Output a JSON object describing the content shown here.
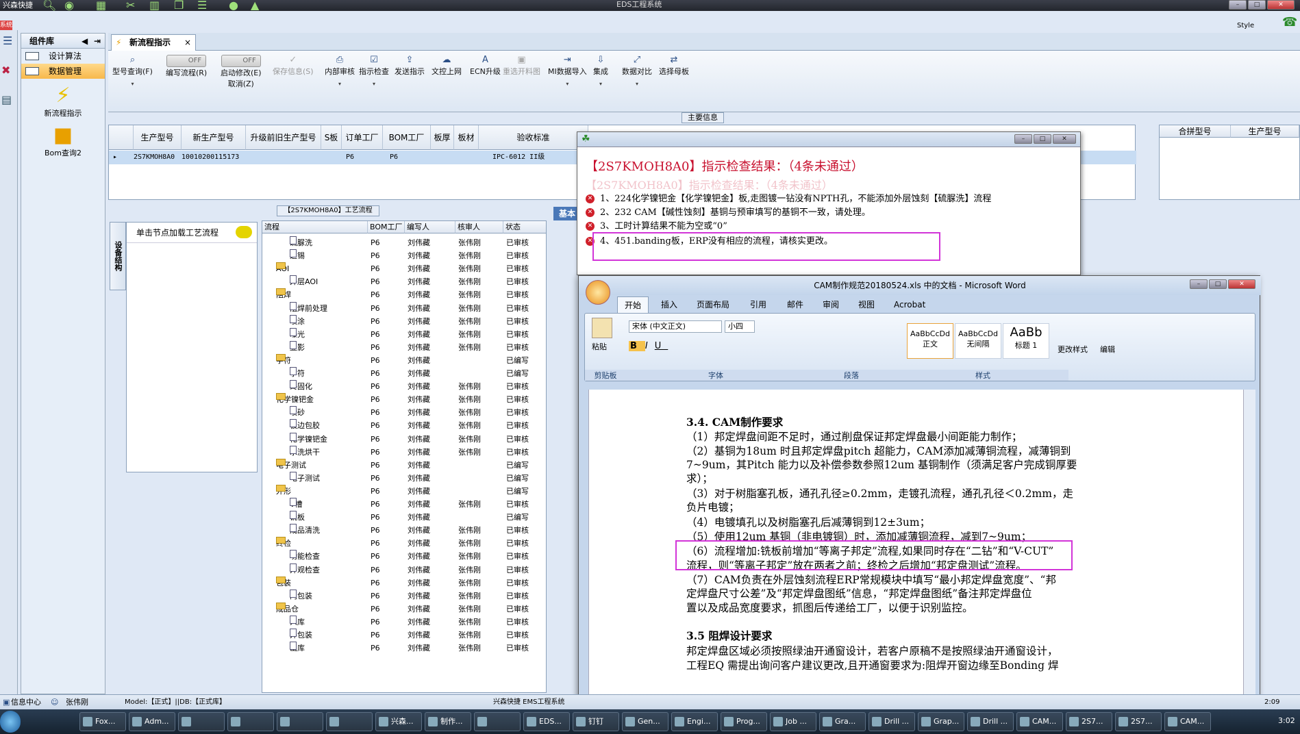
{
  "app": {
    "title": "EDS工程系统",
    "sys_name": "兴森快捷",
    "style_label": "Style",
    "red_tag": "系统"
  },
  "complib": {
    "header": "组件库",
    "items": [
      {
        "label": "设计算法"
      },
      {
        "label": "数据管理"
      }
    ],
    "tiles": [
      {
        "label": "新流程指示"
      },
      {
        "label": "Bom查询2"
      }
    ]
  },
  "tab": {
    "label": "新流程指示",
    "close": "×"
  },
  "ribbon": {
    "model_query": "型号查询(F)",
    "edit_flow": "编写流程(R)",
    "start_modify": "启动修改(E)",
    "cancel": "取消(Z)",
    "off_label": "OFF",
    "save_info": "保存信息(S)",
    "internal_review": "内部审核",
    "instruction_check": "指示检查",
    "send_instruction": "发送指示",
    "upload": "文控上网",
    "ecn_upgrade": "ECN升级",
    "reselect_image": "重选开料图",
    "mi_import": "MI数据导入",
    "integrate": "集成",
    "data_compare": "数据对比",
    "select_mother": "选择母板"
  },
  "main_info_label": "主要信息",
  "top_grid": {
    "headers": [
      "生产型号",
      "新生产型号",
      "升级前旧生产型号",
      "S板",
      "订单工厂",
      "BOM工厂",
      "板厚",
      "板材",
      "验收标准"
    ],
    "row": {
      "model": "2S7KMOH8A0",
      "new_model": "10010200115173",
      "order_factory": "P6",
      "bom_factory": "P6",
      "standard": "IPC-6012 II级"
    },
    "right_headers": [
      "合拼型号",
      "生产型号"
    ]
  },
  "flow_panel_label": "【2S7KMOH8A0】工艺流程",
  "basic_info": "基本",
  "vtab": "设备结构",
  "load_hint": "单击节点加载工艺流程",
  "tree": {
    "headers": [
      "流程",
      "BOM工厂",
      "编写人",
      "核审人",
      "状态"
    ],
    "rows": [
      {
        "t": "g",
        "name": "硫脲洗",
        "bom": "P6",
        "w": "刘伟藏",
        "r": "张伟刚",
        "s": "已审核"
      },
      {
        "t": "c",
        "name": "退锡",
        "bom": "P6",
        "w": "刘伟藏",
        "r": "张伟刚",
        "s": "已审核"
      },
      {
        "t": "f",
        "name": "AOI",
        "bom": "P6",
        "w": "刘伟藏",
        "r": "张伟刚",
        "s": "已审核"
      },
      {
        "t": "c",
        "name": "外层AOI",
        "bom": "P6",
        "w": "刘伟藏",
        "r": "张伟刚",
        "s": "已审核"
      },
      {
        "t": "f",
        "name": "阻焊",
        "bom": "P6",
        "w": "刘伟藏",
        "r": "张伟刚",
        "s": "已审核"
      },
      {
        "t": "c",
        "name": "阻焊前处理",
        "bom": "P6",
        "w": "刘伟藏",
        "r": "张伟刚",
        "s": "已审核"
      },
      {
        "t": "c",
        "name": "喷涂",
        "bom": "P6",
        "w": "刘伟藏",
        "r": "张伟刚",
        "s": "已审核"
      },
      {
        "t": "c",
        "name": "曝光",
        "bom": "P6",
        "w": "刘伟藏",
        "r": "张伟刚",
        "s": "已审核"
      },
      {
        "t": "c",
        "name": "显影",
        "bom": "P6",
        "w": "刘伟藏",
        "r": "张伟刚",
        "s": "已审核"
      },
      {
        "t": "f",
        "name": "字符",
        "bom": "P6",
        "w": "刘伟藏",
        "r": "",
        "s": "已编写"
      },
      {
        "t": "c",
        "name": "字符",
        "bom": "P6",
        "w": "刘伟藏",
        "r": "",
        "s": "已编写"
      },
      {
        "t": "c",
        "name": "终固化",
        "bom": "P6",
        "w": "刘伟藏",
        "r": "张伟刚",
        "s": "已审核"
      },
      {
        "t": "f",
        "name": "化学镍钯金",
        "bom": "P6",
        "w": "刘伟藏",
        "r": "张伟刚",
        "s": "已审核"
      },
      {
        "t": "c",
        "name": "喷砂",
        "bom": "P6",
        "w": "刘伟藏",
        "r": "张伟刚",
        "s": "已审核"
      },
      {
        "t": "c",
        "name": "板边包胶",
        "bom": "P6",
        "w": "刘伟藏",
        "r": "张伟刚",
        "s": "已审核"
      },
      {
        "t": "c",
        "name": "化学镍钯金",
        "bom": "P6",
        "w": "刘伟藏",
        "r": "张伟刚",
        "s": "已审核"
      },
      {
        "t": "c",
        "name": "水洗烘干",
        "bom": "P6",
        "w": "刘伟藏",
        "r": "张伟刚",
        "s": "已审核"
      },
      {
        "t": "f",
        "name": "电子测试",
        "bom": "P6",
        "w": "刘伟藏",
        "r": "",
        "s": "已编写"
      },
      {
        "t": "c",
        "name": "电子测试",
        "bom": "P6",
        "w": "刘伟藏",
        "r": "",
        "s": "已编写"
      },
      {
        "t": "f",
        "name": "外形",
        "bom": "P6",
        "w": "刘伟藏",
        "r": "",
        "s": "已编写"
      },
      {
        "t": "c",
        "name": "V槽",
        "bom": "P6",
        "w": "刘伟藏",
        "r": "张伟刚",
        "s": "已审核"
      },
      {
        "t": "c",
        "name": "铣板",
        "bom": "P6",
        "w": "刘伟藏",
        "r": "",
        "s": "已编写"
      },
      {
        "t": "c",
        "name": "成品清洗",
        "bom": "P6",
        "w": "刘伟藏",
        "r": "张伟刚",
        "s": "已审核"
      },
      {
        "t": "f",
        "name": "终检",
        "bom": "P6",
        "w": "刘伟藏",
        "r": "张伟刚",
        "s": "已审核"
      },
      {
        "t": "c",
        "name": "功能检查",
        "bom": "P6",
        "w": "刘伟藏",
        "r": "张伟刚",
        "s": "已审核"
      },
      {
        "t": "c",
        "name": "外观检查",
        "bom": "P6",
        "w": "刘伟藏",
        "r": "张伟刚",
        "s": "已审核"
      },
      {
        "t": "f",
        "name": "包装",
        "bom": "P6",
        "w": "刘伟藏",
        "r": "张伟刚",
        "s": "已审核"
      },
      {
        "t": "c",
        "name": "内包装",
        "bom": "P6",
        "w": "刘伟藏",
        "r": "张伟刚",
        "s": "已审核"
      },
      {
        "t": "f",
        "name": "成品仓",
        "bom": "P6",
        "w": "刘伟藏",
        "r": "张伟刚",
        "s": "已审核"
      },
      {
        "t": "c",
        "name": "入库",
        "bom": "P6",
        "w": "刘伟藏",
        "r": "张伟刚",
        "s": "已审核"
      },
      {
        "t": "c",
        "name": "外包装",
        "bom": "P6",
        "w": "刘伟藏",
        "r": "张伟刚",
        "s": "已审核"
      },
      {
        "t": "c",
        "name": "出库",
        "bom": "P6",
        "w": "刘伟藏",
        "r": "张伟刚",
        "s": "已审核"
      }
    ]
  },
  "check_dialog": {
    "title": "【2S7KMOH8A0】指示检查结果：（4条未通过）",
    "errors": [
      "1、224化学镍钯金【化学镍钯金】板,走图镀一钻没有NPTH孔，不能添加外层蚀刻【硫脲洗】流程",
      "2、232 CAM【碱性蚀刻】基铜与预审填写的基铜不一致，请处理。",
      "3、工时计算结果不能为空或“0”",
      "4、451.banding板，ERP没有相应的流程，请核实更改。"
    ]
  },
  "word": {
    "title": "CAM制作规范20180524.xls 中的文档 - Microsoft Word",
    "tabs": [
      "开始",
      "插入",
      "页面布局",
      "引用",
      "邮件",
      "审阅",
      "视图",
      "Acrobat"
    ],
    "font_name": "宋体 (中文正文)",
    "font_size": "小四",
    "paste": "粘贴",
    "groups": [
      "剪贴板",
      "字体",
      "段落",
      "样式"
    ],
    "styles": [
      {
        "sample": "AaBbCcDd",
        "name": "正文"
      },
      {
        "sample": "AaBbCcDd",
        "name": "无间隔"
      },
      {
        "sample": "AaBb",
        "name": "标题 1"
      }
    ],
    "change_style": "更改样式",
    "edit": "编辑",
    "lines": [
      "3.4. CAM制作要求",
      "（1）邦定焊盘间距不足时，通过削盘保证邦定焊盘最小间距能力制作；",
      "（2）基铜为18um 时且邦定焊盘pitch 超能力，CAM添加减薄铜流程，减薄铜到",
      "7~9um，其Pitch 能力以及补偿参数参照12um 基铜制作（须满足客户完成铜厚要",
      "求）；",
      "（3）对于树脂塞孔板，通孔孔径≥0.2mm，走镀孔流程，通孔孔径＜0.2mm，走",
      "负片电镀；",
      "（4）电镀填孔以及树脂塞孔后减薄铜到12±3um；",
      "（5）使用12um 基铜（非电镀铜）时，添加减薄铜流程，减到7~9um；",
      "（6）流程增加:铣板前增加“等离子邦定”流程,如果同时存在“二钻”和“V-CUT”",
      "流程，则“等离子邦定”放在两者之前；终检之后增加“邦定盘测试”流程。",
      "（7）CAM负责在外层蚀刻流程ERP常规模块中填写“最小邦定焊盘宽度”、“邦",
      "定焊盘尺寸公差”及“邦定焊盘图纸”信息，“邦定焊盘图纸”备注邦定焊盘位",
      "置以及成品宽度要求，抓图后传递给工厂，以便于识别监控。",
      "3.5  阻焊设计要求",
      "邦定焊盘区域必须按照绿油开通窗设计，若客户原稿不是按照绿油开通窗设计，",
      "工程EQ 需提出询问客户建议更改,且开通窗要求为:阻焊开窗边缘至Bonding 焊"
    ]
  },
  "status": {
    "info_center": "信息中心",
    "user": "张伟刚",
    "model": "Model:【正式】||DB:【正式库】",
    "right": "兴森快捷 EMS工程系统",
    "time_right": "2:09"
  },
  "taskbar": {
    "buttons": [
      "Fox...",
      "Adm...",
      "",
      "",
      "",
      "",
      "兴森...",
      "制作...",
      "",
      "EDS...",
      "钉钉",
      "Gen...",
      "Engi...",
      "Prog...",
      "Job ...",
      "Gra...",
      "Drill ...",
      "Grap...",
      "Drill ...",
      "CAM...",
      "2S7...",
      "2S7...",
      "CAM..."
    ],
    "clock": "3:02"
  }
}
